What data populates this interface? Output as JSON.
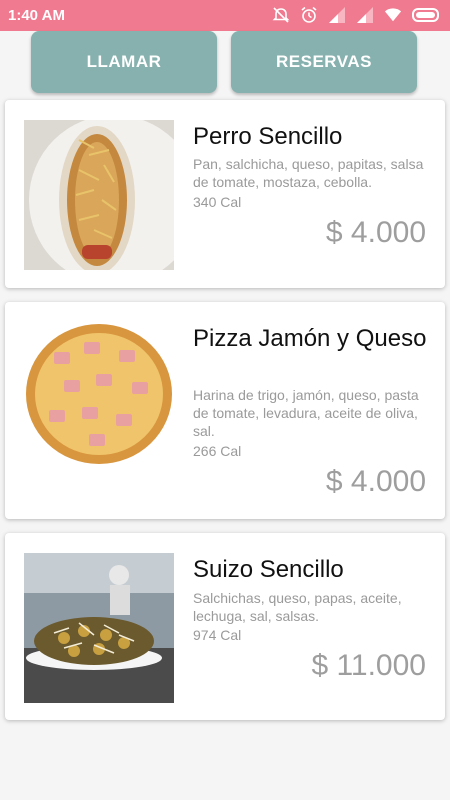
{
  "status_bar": {
    "time": "1:40 AM",
    "icons": [
      "alarm-off-icon",
      "alarm-icon",
      "signal-icon",
      "signal-icon",
      "wifi-icon",
      "battery-icon"
    ]
  },
  "buttons": {
    "call_label": "LLAMAR",
    "reserve_label": "RESERVAS"
  },
  "colors": {
    "status_bar": "#f07a8f",
    "button": "#86b1ae"
  },
  "menu": {
    "items": [
      {
        "title": "Perro Sencillo",
        "description": "Pan, salchicha, queso, papitas, salsa de tomate, mostaza, cebolla.",
        "calories": "340 Cal",
        "price": "$ 4.000"
      },
      {
        "title": "Pizza Jamón y Queso",
        "description": "Harina de trigo, jamón, queso, pasta de tomate, levadura, aceite de oliva, sal.",
        "calories": "266 Cal",
        "price": "$ 4.000"
      },
      {
        "title": "Suizo Sencillo",
        "description": "Salchichas, queso, papas, aceite, lechuga, sal, salsas.",
        "calories": "974 Cal",
        "price": "$ 11.000"
      }
    ]
  }
}
